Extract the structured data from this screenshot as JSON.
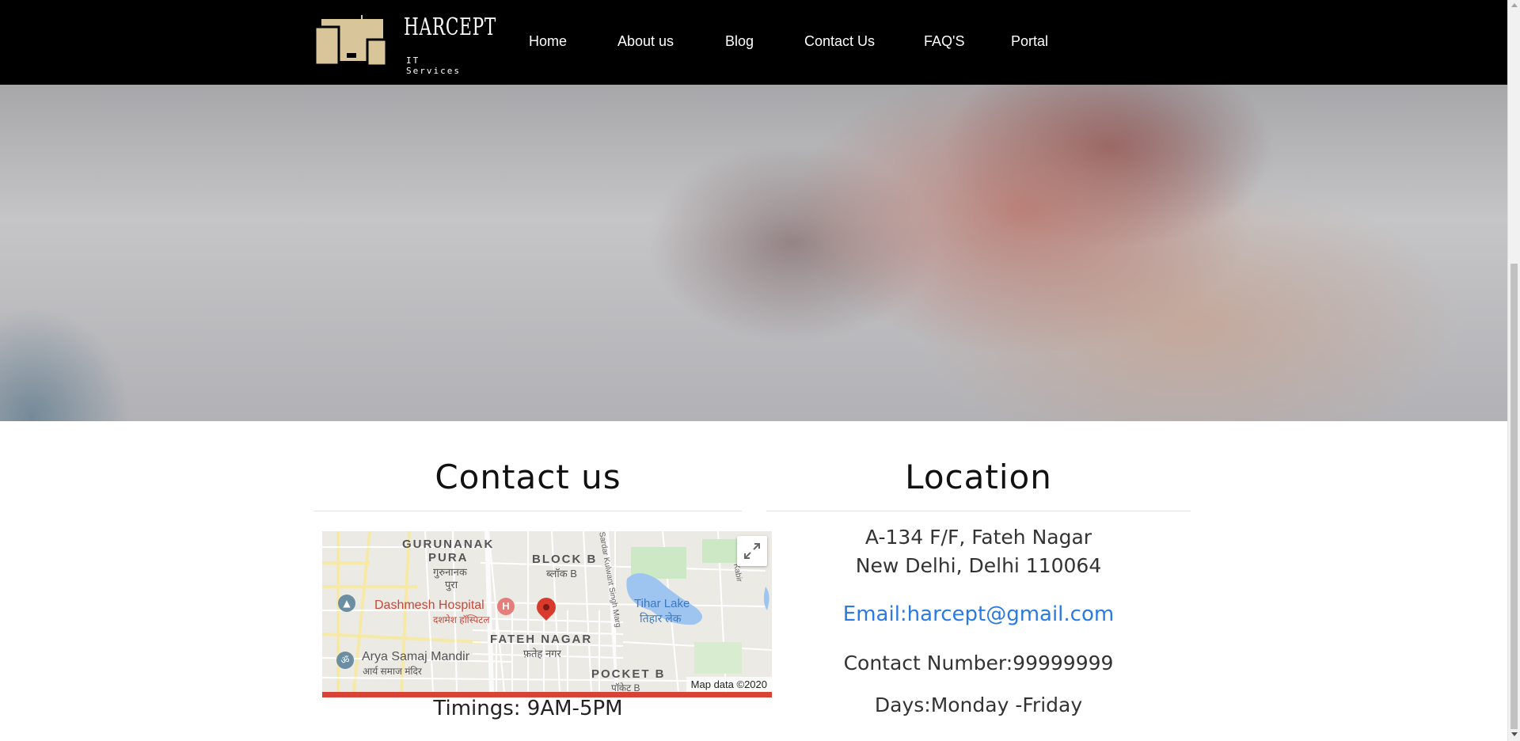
{
  "nav": {
    "brand": "HARCEPT",
    "brand_sub": "IT Services",
    "items": [
      "Home",
      "About us",
      "Blog",
      "Contact Us",
      "FAQ'S",
      "Portal"
    ]
  },
  "contact": {
    "title": "Contact us",
    "timings": "Timings: 9AM-5PM"
  },
  "map": {
    "labels": {
      "gurunanak": "GURUNANAK",
      "pura": "PURA",
      "gurunanak_hi": "गुरुनानक",
      "pura_hi": "पुरा",
      "block_b": "BLOCK B",
      "block_b_hi": "ब्लॉक B",
      "sardar": "Sardar Kulwant Singh Marg",
      "dashmesh": "Dashmesh Hospital",
      "dashmesh_hi": "दशमेश हॉस्पिटल",
      "tihar": "Tihar Lake",
      "tihar_hi": "तिहार लेक",
      "fateh": "FATEH NAGAR",
      "fateh_hi": "फ़तेह नगर",
      "arya": "Arya Samaj Mandir",
      "arya_hi": "आर्य समाज मंदिर",
      "pocket": "POCKET B",
      "pocket_hi": "पॉकेट B",
      "kabir": "Kabir"
    },
    "attribution": "Map data ©2020"
  },
  "location": {
    "title": "Location",
    "address1": "A-134 F/F, Fateh Nagar",
    "address2": "New Delhi, Delhi 110064",
    "email": "Email:harcept@gmail.com",
    "phone": "Contact Number:99999999",
    "days": "Days:Monday -Friday"
  },
  "colors": {
    "nav_bg": "#000000",
    "logo_gold": "#d9c59a",
    "link_blue": "#2a7ae4",
    "map_accent": "#d74436"
  }
}
